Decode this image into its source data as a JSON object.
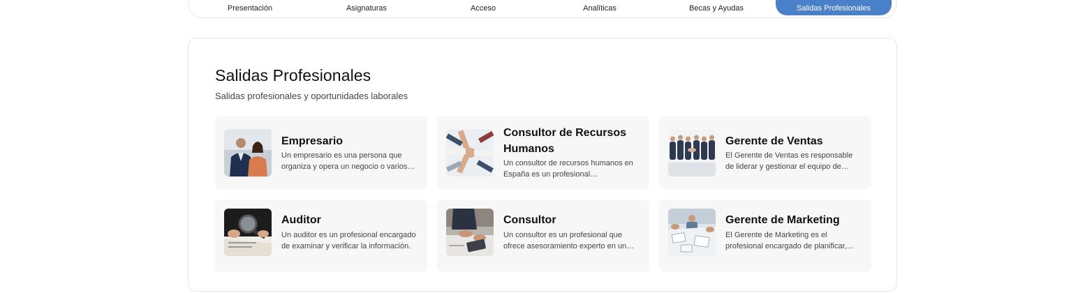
{
  "tabs": [
    {
      "label": "Presentación",
      "icon": "info-icon",
      "active": false
    },
    {
      "label": "Asignaturas",
      "icon": "book-icon",
      "active": false
    },
    {
      "label": "Acceso",
      "icon": "users-icon",
      "active": false
    },
    {
      "label": "Analíticas",
      "icon": "calendar-chart-icon",
      "active": false
    },
    {
      "label": "Becas y Ayudas",
      "icon": "folder-icon",
      "active": false
    },
    {
      "label": "Salidas Profesionales",
      "icon": "clipboard-icon",
      "active": true
    }
  ],
  "section": {
    "title": "Salidas Profesionales",
    "subtitle": "Salidas profesionales y oportunidades laborales"
  },
  "careers": [
    {
      "title": "Empresario",
      "description": "Un empresario es una persona que organiza y opera un negocio o varios negocios."
    },
    {
      "title": "Consultor de Recursos Humanos",
      "description": "Un consultor de recursos humanos en España es un profesional especializado."
    },
    {
      "title": "Gerente de Ventas",
      "description": "El Gerente de Ventas es responsable de liderar y gestionar el equipo de ventas."
    },
    {
      "title": "Auditor",
      "description": "Un auditor es un profesional encargado de examinar y verificar la información."
    },
    {
      "title": "Consultor",
      "description": "Un consultor es un profesional que ofrece asesoramiento experto en un área."
    },
    {
      "title": "Gerente de Marketing",
      "description": "El Gerente de Marketing es el profesional encargado de planificar, dirigir."
    }
  ],
  "colors": {
    "accent": "#4a7fc9",
    "card_bg": "#f7f7f7"
  }
}
